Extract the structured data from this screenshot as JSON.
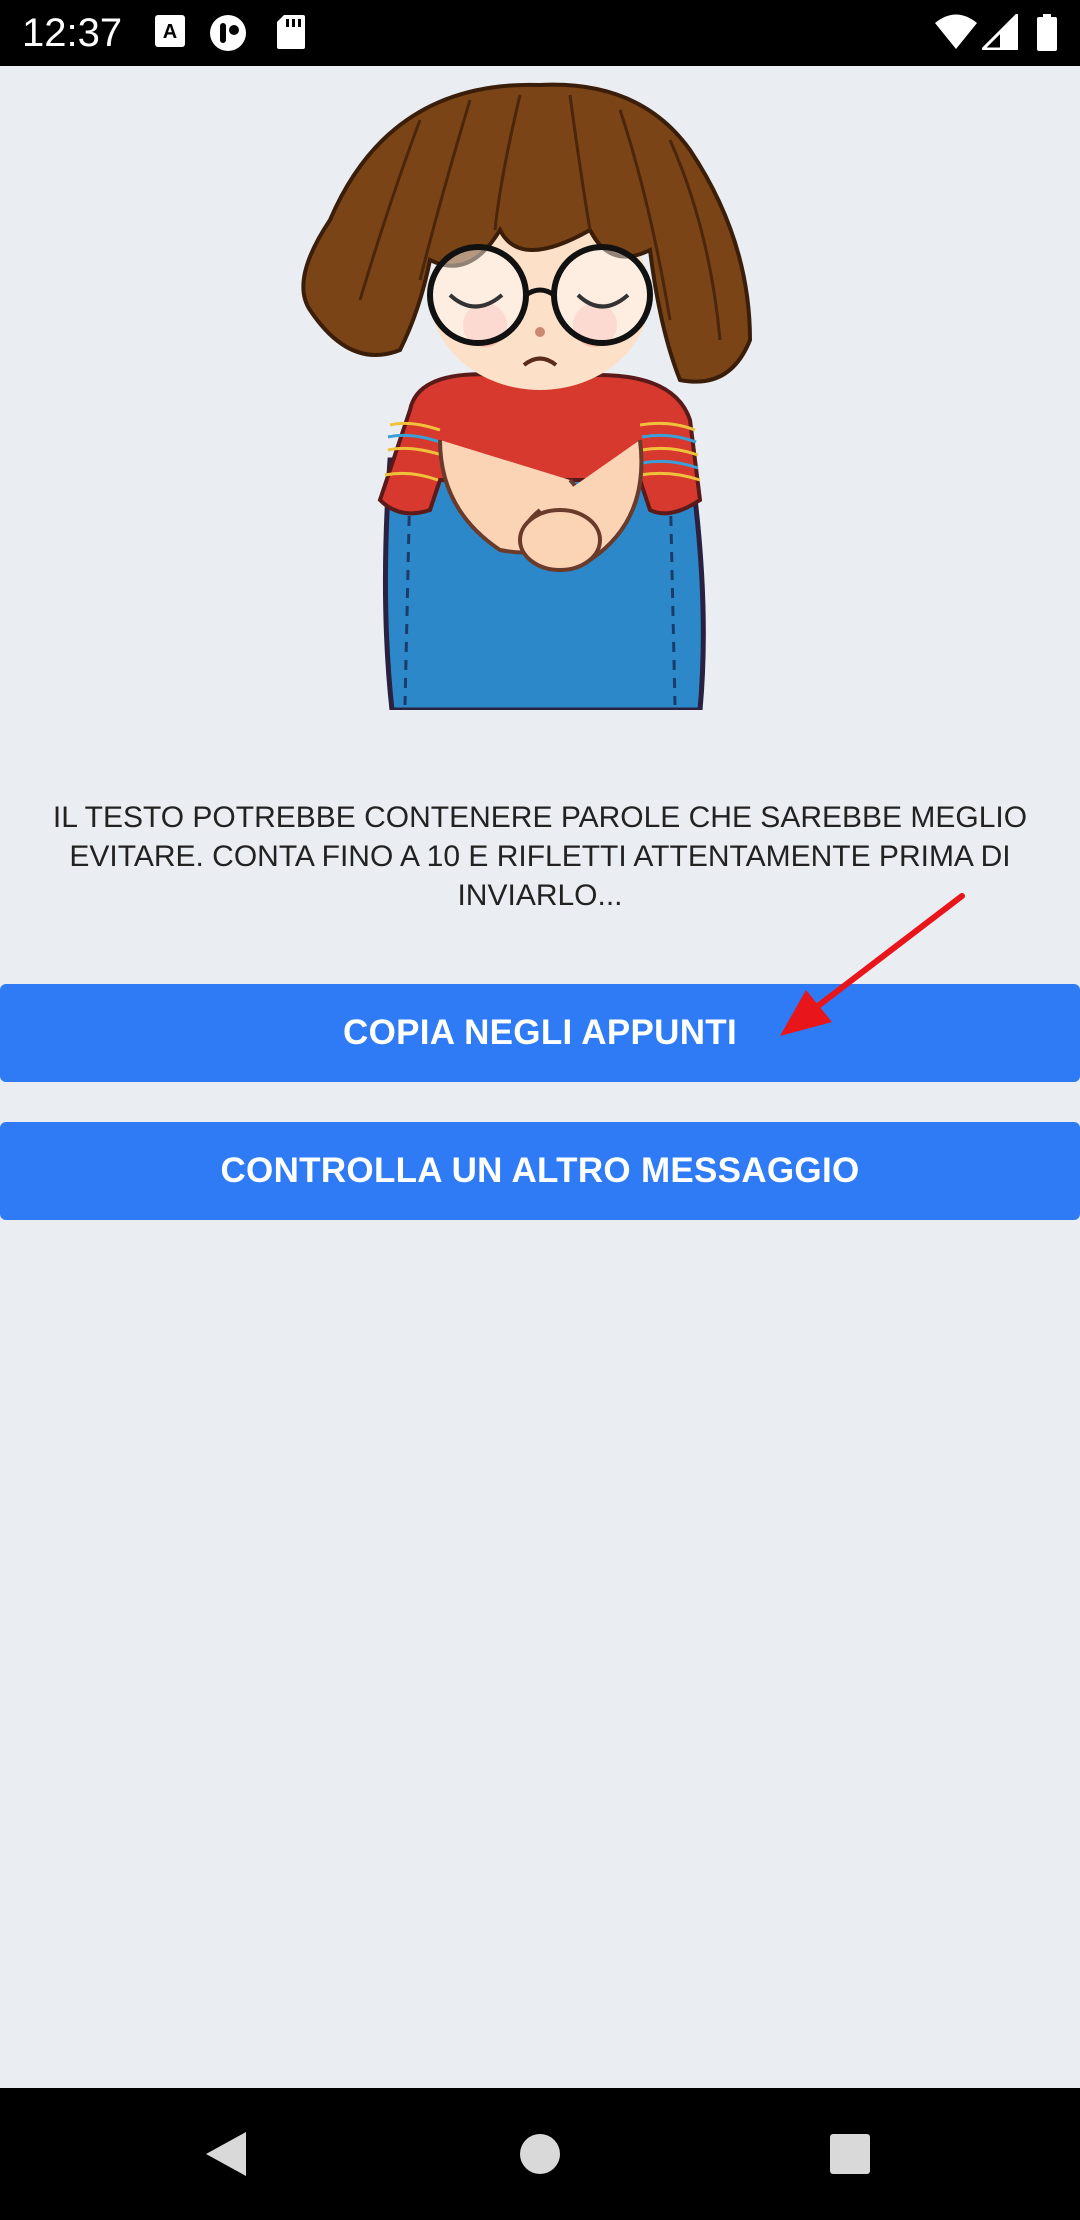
{
  "status_bar": {
    "time": "12:37",
    "icons": [
      "font-a-icon",
      "assistant-icon",
      "sd-card-icon",
      "wifi-icon",
      "signal-icon",
      "battery-icon"
    ]
  },
  "illustration": {
    "description_icon": "sad-girl-sticker-icon"
  },
  "message": {
    "text": "IL TESTO POTREBBE CONTENERE PAROLE CHE SAREBBE MEGLIO EVITARE. CONTA FINO A 10 E RIFLETTI ATTENTAMENTE PRIMA DI INVIARLO..."
  },
  "buttons": {
    "copy_label": "COPIA NEGLI APPUNTI",
    "check_label": "CONTROLLA UN ALTRO MESSAGGIO"
  },
  "nav_bar": {
    "icons": [
      "back-icon",
      "home-icon",
      "recents-icon"
    ]
  },
  "colors": {
    "background": "#eaedf1",
    "button": "#2f7bf6",
    "annotation_arrow": "#e8151b"
  }
}
